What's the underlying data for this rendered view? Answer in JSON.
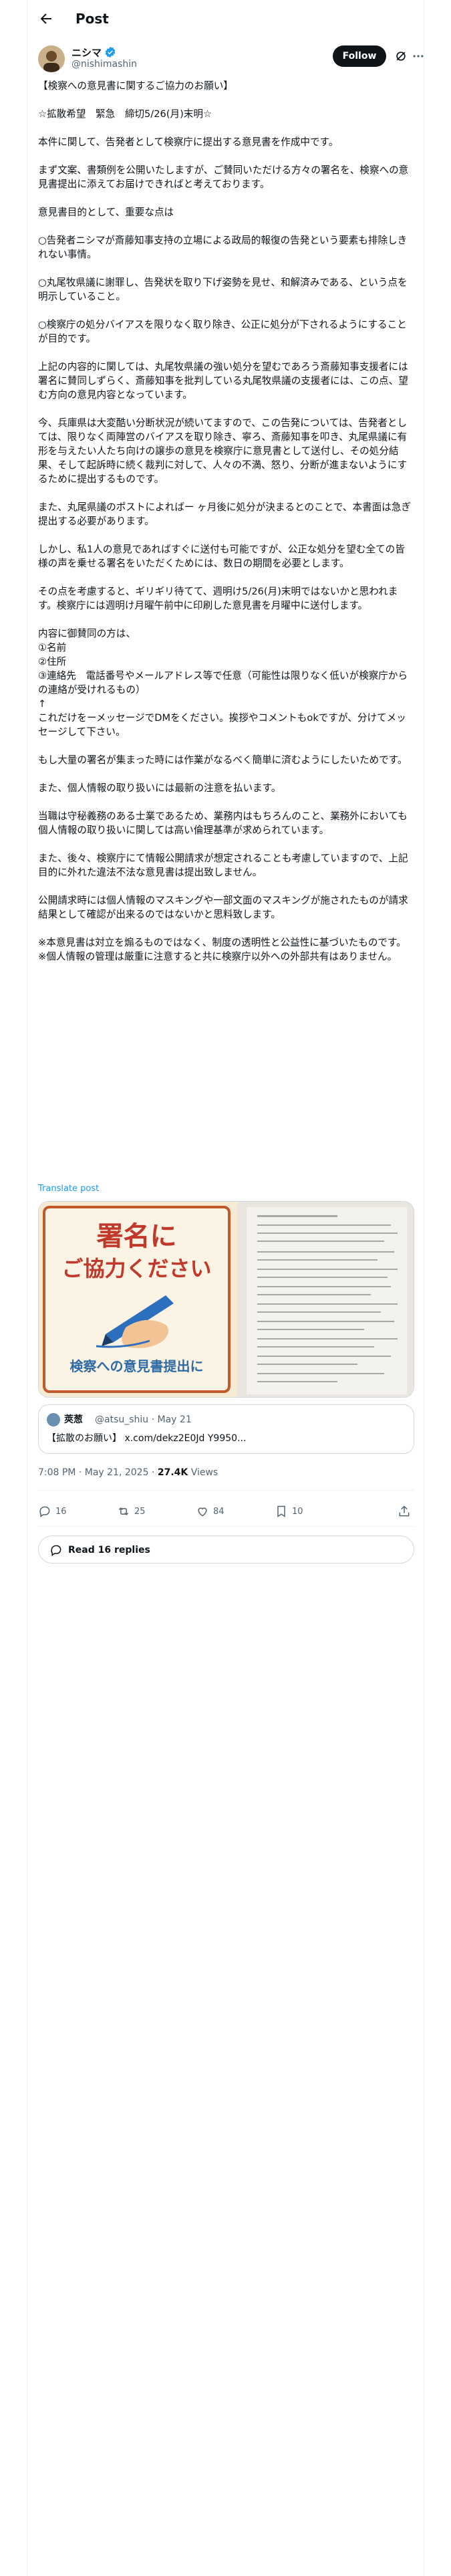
{
  "header": {
    "title": "Post"
  },
  "author": {
    "display_name": "ニシマ",
    "handle": "@nishimashin",
    "follow_label": "Follow"
  },
  "post": {
    "paragraphs": [
      "【検察への意見書に関するご協力のお願い】",
      "☆拡散希望　緊急　締切5/26(月)末明☆",
      "本件に関して、告発者として検察庁に提出する意見書を作成中です。",
      "まず文案、書類例を公開いたしますが、ご賛同いただける方々の署名を、検察への意見書提出に添えてお届けできればと考えております。",
      "意見書目的として、重要な点は",
      "○告発者ニシマが斎藤知事支持の立場による政局的報復の告発という要素も排除しきれない事情。",
      "○丸尾牧県議に謝罪し、告発状を取り下げ姿勢を見せ、和解済みである、という点を明示していること。",
      "○検察庁の処分バイアスを限りなく取り除き、公正に処分が下されるようにすることが目的です。",
      "上記の内容的に関しては、丸尾牧県議の強い処分を望むであろう斎藤知事支援者には署名に賛同しずらく、斎藤知事を批判している丸尾牧県議の支援者には、この点、望む方向の意見内容となっています。",
      "今、兵庫県は大変酷い分断状況が続いてますので、この告発については、告発者としては、限りなく両陣営のバイアスを取り除き、寧ろ、斎藤知事を叩き、丸尾県議に有形を与えたい人たち向けの譲歩の意見を検察庁に意見書として送付し、その処分結果、そして起訴時に続く裁判に対して、人々の不満、怒り、分断が進まないようにするために提出するものです。",
      "また、丸尾県議のポストによればー ヶ月後に処分が決まるとのことで、本書面は急ぎ提出する必要があります。",
      "しかし、私1人の意見であればすぐに送付も可能ですが、公正な処分を望む全ての皆様の声を乗せる署名をいただくためには、数日の期間を必要とします。",
      "その点を考慮すると、ギリギリ待てて、週明け5/26(月)末明ではないかと思われます。検察庁には週明け月曜午前中に印刷した意見書を月曜中に送付します。",
      "内容に御賛同の方は、\n①名前\n②住所\n③連絡先　電話番号やメールアドレス等で任意（可能性は限りなく低いが検察庁からの連絡が受けれるもの）\n↑\nこれだけをーメッセージでDMをください。挨拶やコメントもokですが、分けてメッセージして下さい。",
      "もし大量の署名が集まった時には作業がなるべく簡単に済むようにしたいためです。",
      "また、個人情報の取り扱いには最新の注意を払います。",
      "当職は守秘義務のある士業であるため、業務内はもちろんのこと、業務外においても個人情報の取り扱いに関しては高い倫理基準が求められています。",
      "また、後々、検察庁にて情報公開請求が想定されることも考慮していますので、上記目的に外れた違法不法な意見書は提出致しません。",
      "公開請求時には個人情報のマスキングや一部文面のマスキングが施されたものが請求結果として確認が出来るのではないかと思料致します。",
      "※本意見書は対立を煽るものではなく、制度の透明性と公益性に基づいたものです。\n※個人情報の管理は厳重に注意すると共に検察庁以外への外部共有はありません。"
    ],
    "translate_label": "Translate post"
  },
  "media": {
    "image_title_line1": "署名に",
    "image_title_line2": "ご協力ください",
    "image_subtitle": "検察への意見書提出に"
  },
  "quote": {
    "name": "莢葱",
    "handle": "@atsu_shiu · May 21",
    "text": "【拡散のお願い】 x.com/dekz2E0Jd Y9950..."
  },
  "meta": {
    "timestamp": "7:08 PM · May 21, 2025 · ",
    "views_count": "27.4K",
    "views_label": " Views"
  },
  "actions": {
    "replies": "16",
    "reposts": "25",
    "likes": "84",
    "bookmarks": "10"
  },
  "read_replies": {
    "label": "Read 16 replies"
  },
  "colors": {
    "link": "#1d9bf0",
    "text": "#0f1419",
    "muted": "#536471",
    "verified": "#1d9bf0"
  }
}
